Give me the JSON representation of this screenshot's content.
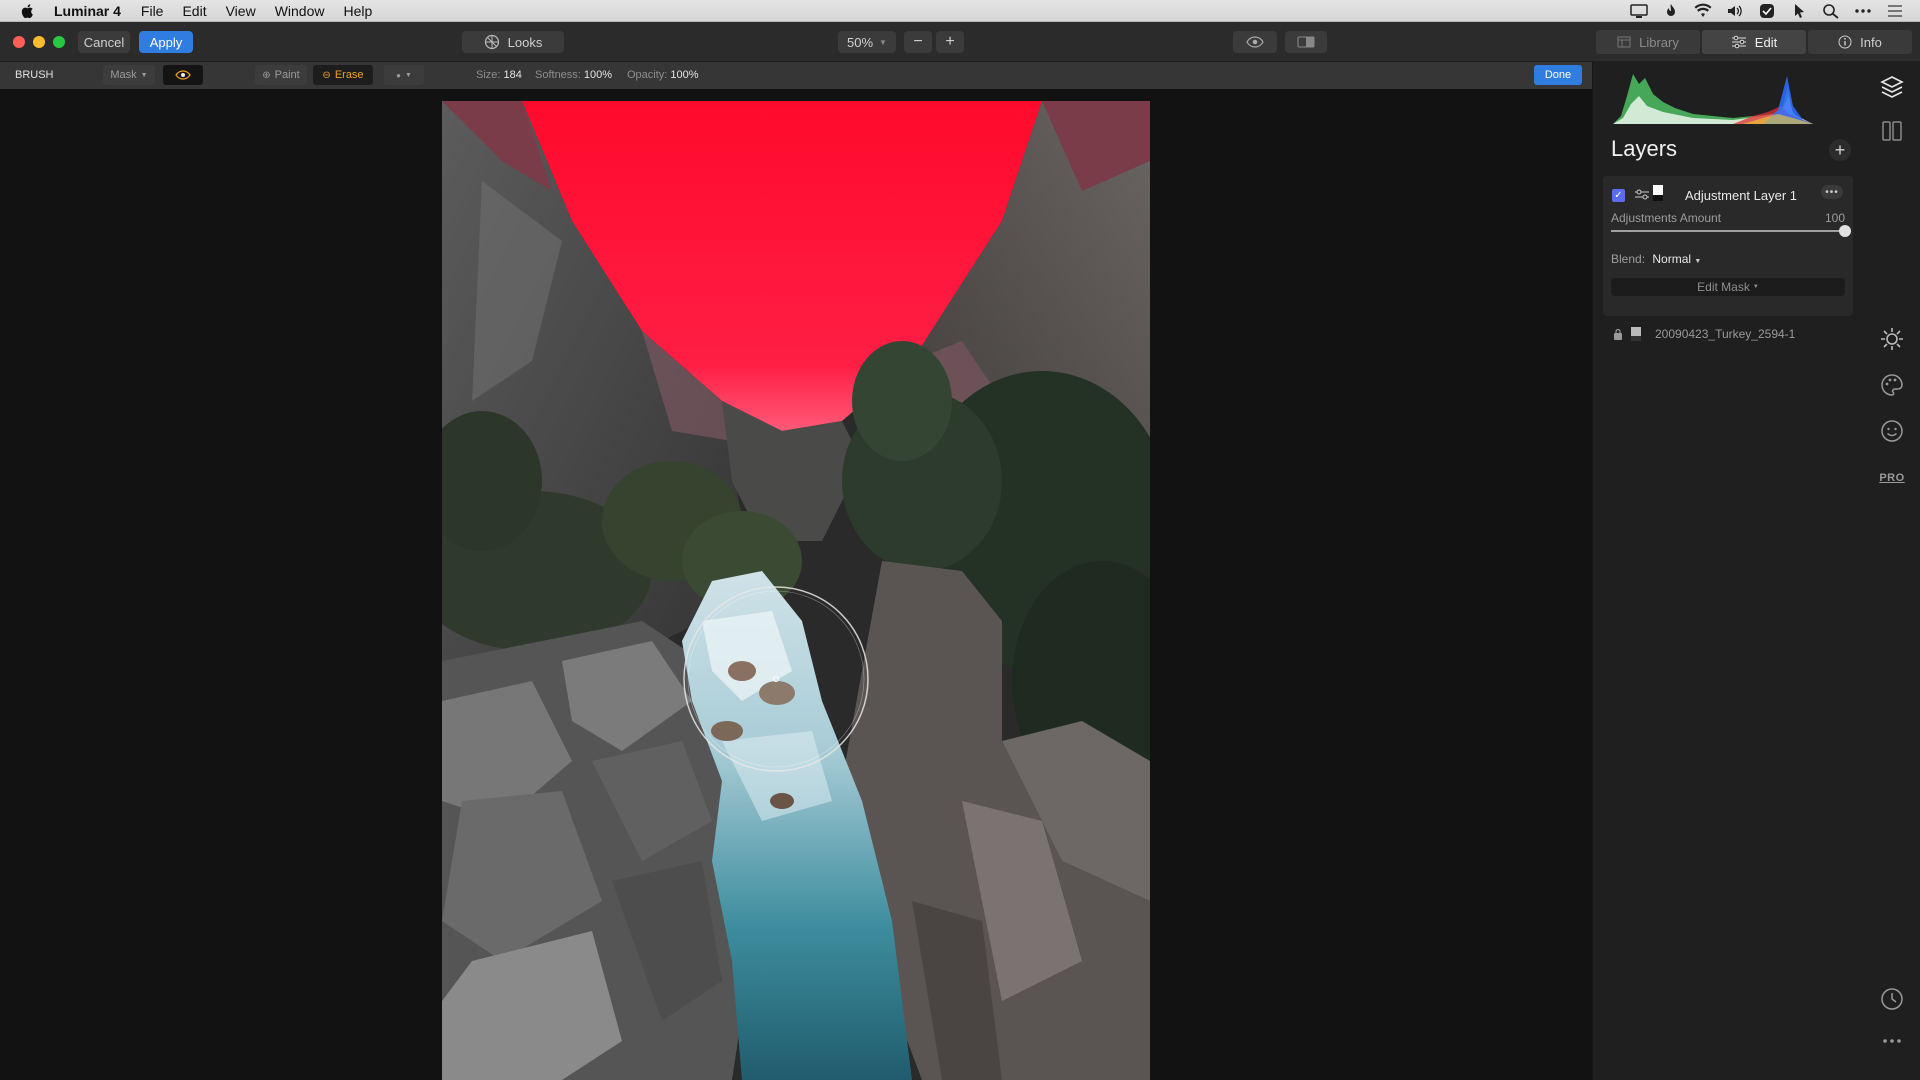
{
  "menubar": {
    "app_name": "Luminar 4",
    "items": [
      "File",
      "Edit",
      "View",
      "Window",
      "Help"
    ]
  },
  "toolbar": {
    "cancel_label": "Cancel",
    "apply_label": "Apply",
    "looks_label": "Looks",
    "zoom_value": "50%",
    "tabs": [
      {
        "label": "Library",
        "icon": "library-icon",
        "active": false
      },
      {
        "label": "Edit",
        "icon": "sliders-icon",
        "active": true
      },
      {
        "label": "Info",
        "icon": "info-icon",
        "active": false
      }
    ]
  },
  "brushbar": {
    "title": "BRUSH",
    "mask_label": "Mask",
    "paint_label": "Paint",
    "erase_label": "Erase",
    "size_label": "Size:",
    "size_value": "184",
    "softness_label": "Softness:",
    "softness_value": "100%",
    "opacity_label": "Opacity:",
    "opacity_value": "100%",
    "done_label": "Done"
  },
  "panel": {
    "title": "Layers",
    "layer": {
      "name": "Adjustment Layer 1",
      "checked": true,
      "amount_label": "Adjustments Amount",
      "amount_value": "100",
      "amount_fraction": 1.0,
      "blend_label": "Blend:",
      "blend_value": "Normal",
      "edit_mask_label": "Edit Mask"
    },
    "base_layer_name": "20090423_Turkey_2594-1"
  },
  "colors": {
    "accent_blue": "#2f7de1",
    "erase_orange": "#f0a020",
    "mask_red": "#ff1a3c"
  },
  "tool_rail": [
    "layers-icon",
    "canvas-icon",
    "sun-icon",
    "palette-icon",
    "face-icon",
    "pro-badge",
    "history-icon",
    "more-icon"
  ],
  "tool_rail_pro_label": "PRO"
}
